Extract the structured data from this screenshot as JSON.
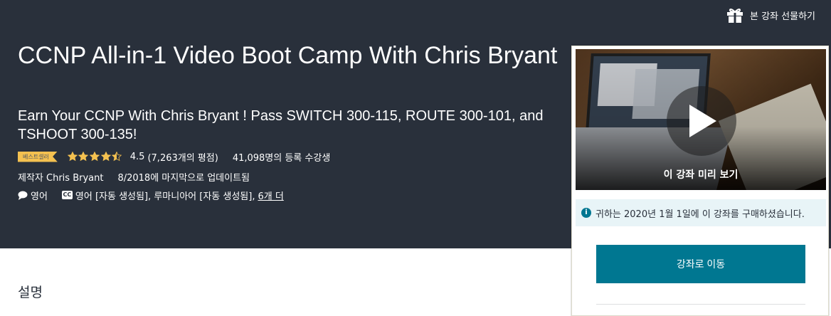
{
  "header": {
    "gift_label": "본 강좌 선물하기"
  },
  "course": {
    "title": "CCNP All-in-1 Video Boot Camp With Chris Bryant",
    "subtitle": "Earn Your CCNP With Chris Bryant ! Pass SWITCH 300-115, ROUTE 300-101, and TSHOOT 300-135!",
    "badge": "베스트셀러",
    "rating_value": "4.5",
    "rating_stars": 4.5,
    "rating_count": "(7,263개의 평점)",
    "enrollment": "41,098명의 등록 수강생",
    "author": "제작자 Chris Bryant",
    "updated": "8/2018에 마지막으로 업데이트됨",
    "language": "영어",
    "captions": "영어 [자동 생성됨], 루마니아어 [자동 생성됨],",
    "captions_more": "6개 더"
  },
  "sidebar": {
    "preview_label": "이 강좌 미리 보기",
    "notice": "귀하는 2020년 1월 1일에 이 강좌를 구매하셨습니다.",
    "go_button": "강좌로 이동"
  },
  "main": {
    "description_heading": "설명"
  },
  "colors": {
    "hero_bg": "#29303b",
    "badge_bg": "#f4c150",
    "star": "#f4c150",
    "primary": "#007791",
    "notice_bg": "#e8f4f7"
  },
  "icons": {
    "gift": "gift-icon",
    "star": "star-icon",
    "speech": "speech-bubble-icon",
    "cc": "closed-captions-icon",
    "play": "play-icon",
    "info": "info-icon"
  }
}
